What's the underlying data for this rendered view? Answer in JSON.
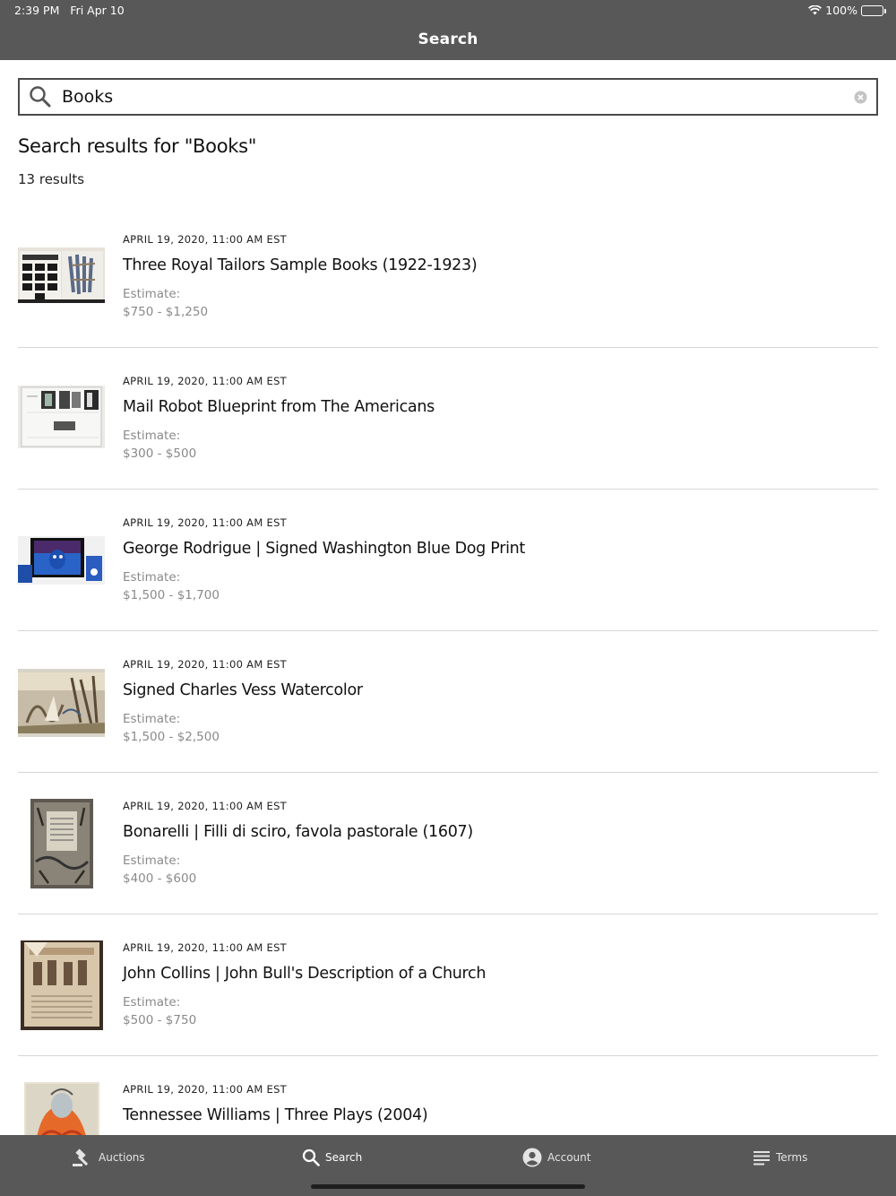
{
  "status_bar": {
    "time": "2:39 PM",
    "date": "Fri Apr 10",
    "battery": "100%",
    "battery_level": 1.0
  },
  "nav": {
    "title": "Search"
  },
  "search": {
    "value": "Books",
    "placeholder": ""
  },
  "results": {
    "title": "Search results for \"Books\"",
    "count": "13 results",
    "estimate_label": "Estimate:",
    "items": [
      {
        "date": "APRIL 19, 2020, 11:00 AM EST",
        "title": "Three Royal Tailors Sample Books (1922-1923)",
        "estimate": "$750 - $1,250"
      },
      {
        "date": "APRIL 19, 2020, 11:00 AM EST",
        "title": "Mail Robot Blueprint from The Americans",
        "estimate": "$300 - $500"
      },
      {
        "date": "APRIL 19, 2020, 11:00 AM EST",
        "title": "George Rodrigue | Signed Washington Blue Dog Print",
        "estimate": "$1,500 - $1,700"
      },
      {
        "date": "APRIL 19, 2020, 11:00 AM EST",
        "title": "Signed Charles Vess Watercolor",
        "estimate": "$1,500 - $2,500"
      },
      {
        "date": "APRIL 19, 2020, 11:00 AM EST",
        "title": "Bonarelli | Filli di sciro, favola pastorale (1607)",
        "estimate": "$400 - $600"
      },
      {
        "date": "APRIL 19, 2020, 11:00 AM EST",
        "title": "John Collins | John Bull's Description of a Church",
        "estimate": "$500 - $750"
      },
      {
        "date": "APRIL 19, 2020, 11:00 AM EST",
        "title": "Tennessee Williams | Three Plays (2004)",
        "estimate": ""
      }
    ]
  },
  "tabbar": {
    "auctions": "Auctions",
    "search": "Search",
    "account": "Account",
    "terms": "Terms"
  },
  "colors": {
    "bar": "#585858",
    "muted_text": "#8a8a8a",
    "divider": "#d6d6d6"
  }
}
